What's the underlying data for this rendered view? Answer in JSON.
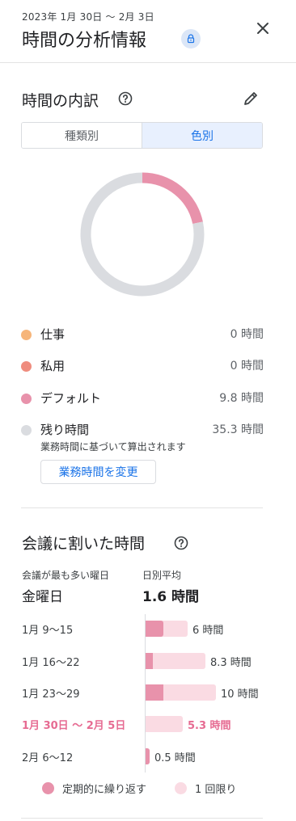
{
  "header": {
    "date_range": "2023年 1月 30日 ～ 2月 3日",
    "title": "時間の分析情報"
  },
  "breakdown": {
    "title": "時間の内訳",
    "segments": [
      "種類別",
      "色別"
    ],
    "selected_segment": "色別",
    "donut": [
      {
        "name": "デフォルト",
        "value": 9.8,
        "color": "#e892ab"
      },
      {
        "name": "残り時間",
        "value": 35.3,
        "color": "#dadce0"
      }
    ],
    "legend": [
      {
        "label": "仕事",
        "value": "0 時間",
        "color": "#f6b57a"
      },
      {
        "label": "私用",
        "value": "0 時間",
        "color": "#ef8c7e"
      },
      {
        "label": "デフォルト",
        "value": "9.8 時間",
        "color": "#e892ab"
      },
      {
        "label": "残り時間",
        "value": "35.3 時間",
        "color": "#dadce0"
      }
    ],
    "remaining_note": "業務時間に基づいて算出されます",
    "change_button": "業務時間を変更"
  },
  "meetings": {
    "title": "会議に割いた時間",
    "busiest_day_label": "会議が最も多い曜日",
    "busiest_day_value": "金曜日",
    "daily_avg_label": "日別平均",
    "daily_avg_value": "1.6 時間",
    "weeks": [
      {
        "label": "1月 9〜15",
        "total": 6,
        "recurring": 6,
        "value_text": "6 時間",
        "current": false
      },
      {
        "label": "1月 16〜22",
        "total": 8.3,
        "recurring": 2.5,
        "value_text": "8.3 時間",
        "current": false
      },
      {
        "label": "1月 23〜29",
        "total": 10,
        "recurring": 6,
        "value_text": "10 時間",
        "current": false
      },
      {
        "label": "1月 30日 〜 2月 5日",
        "total": 5.3,
        "recurring": 0,
        "value_text": "5.3 時間",
        "current": true
      },
      {
        "label": "2月 6〜12",
        "total": 0.5,
        "recurring": 0.5,
        "value_text": "0.5 時間",
        "current": false
      }
    ],
    "key": [
      {
        "label": "定期的に繰り返す",
        "color": "#e892ab"
      },
      {
        "label": "1 回限り",
        "color": "#fadbe3"
      }
    ]
  }
}
